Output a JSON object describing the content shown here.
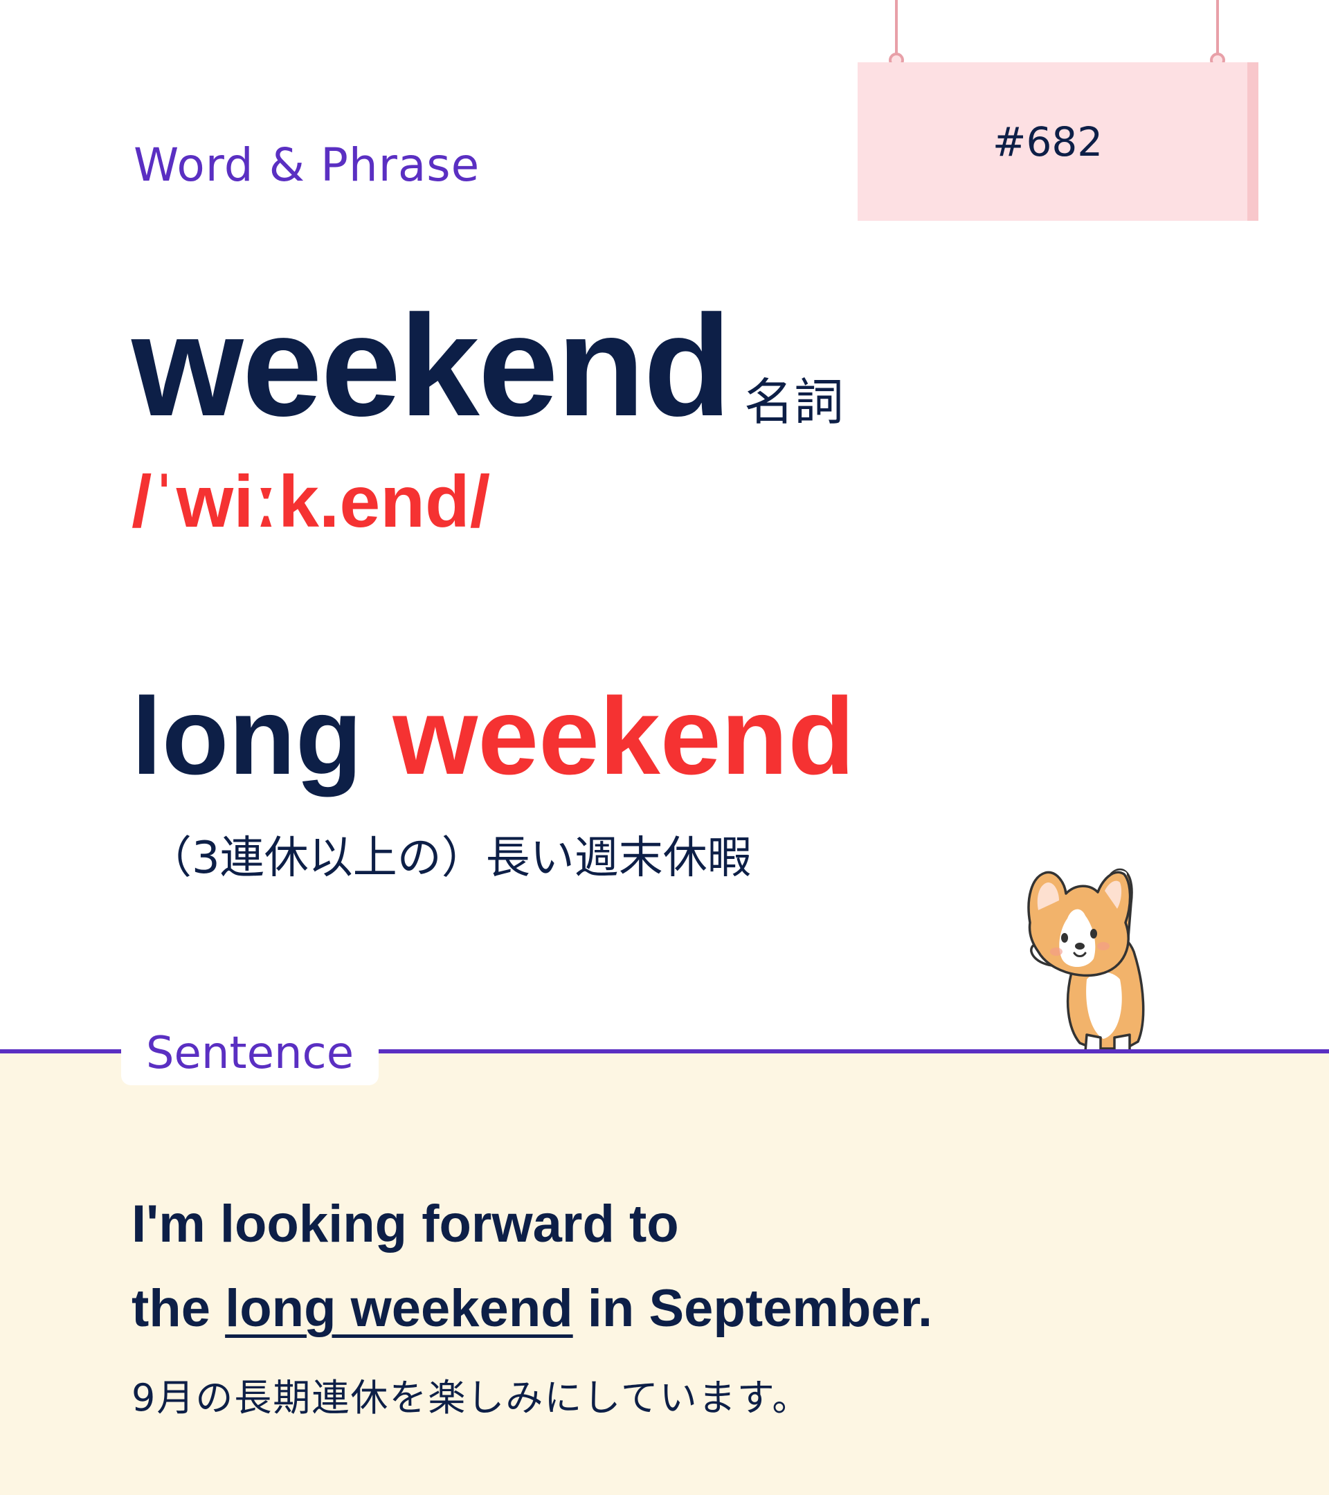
{
  "category": "Word & Phrase",
  "sign": {
    "number": "#682"
  },
  "word": {
    "headword": "weekend",
    "part_of_speech": "名詞",
    "pronunciation": "/ˈwiːk.end/"
  },
  "phrase": {
    "plain": "long ",
    "accent": "weekend",
    "meaning": "（3連休以上の）長い週末休暇"
  },
  "sentence": {
    "tag": "Sentence",
    "line1": "I'm looking forward to",
    "line2_before": "the ",
    "line2_target": "long weekend",
    "line2_after": " in September.",
    "translation": "9月の長期連休を楽しみにしています。"
  },
  "colors": {
    "navy": "#0d1f47",
    "red": "#f53232",
    "purple": "#5a2fc2",
    "sign_pink": "#fde0e3",
    "cream": "#fdf6e3"
  },
  "illustration": {
    "icon": "corgi-stretching-icon"
  }
}
